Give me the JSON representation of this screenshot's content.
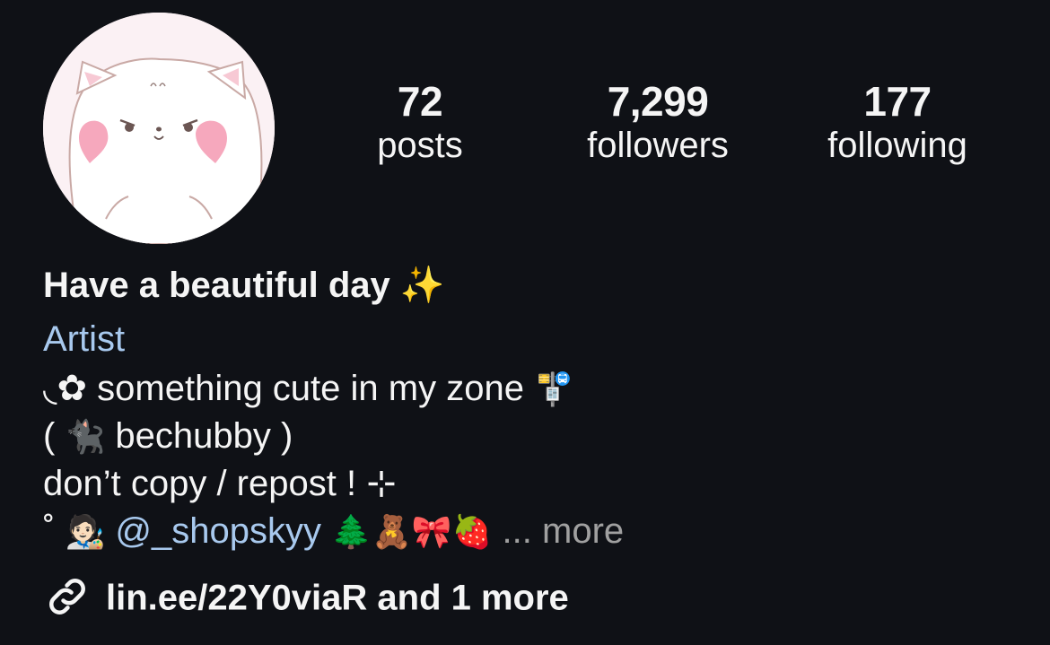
{
  "profile": {
    "stats": [
      {
        "value": "72",
        "label": "posts"
      },
      {
        "value": "7,299",
        "label": "followers"
      },
      {
        "value": "177",
        "label": "following"
      }
    ],
    "name": "Have a beautiful day ✨",
    "category": "Artist",
    "bio": {
      "line1_prefix": "◟✿",
      "line1_text": "something cute in my zone",
      "line1_emoji": "🚏",
      "line2_open": "(",
      "line2_emoji": "🐈‍⬛",
      "line2_text": "bechubby )",
      "line3": "don’t copy / repost ! ⊹",
      "line4_prefix": "˚",
      "line4_emoji1": "🧑🏻‍🎨",
      "mention": "@_shopskyy",
      "line4_emojis": "🌲🧸🎀🍓",
      "ellipsis": "...",
      "more": "more"
    },
    "link": {
      "text": "lin.ee/22Y0viaR and 1 more",
      "icon": "link-icon"
    }
  },
  "colors": {
    "background": "#0f1116",
    "text": "#f5f5f5",
    "accent_link": "#a8c9ee",
    "muted": "#a0a0a0"
  }
}
